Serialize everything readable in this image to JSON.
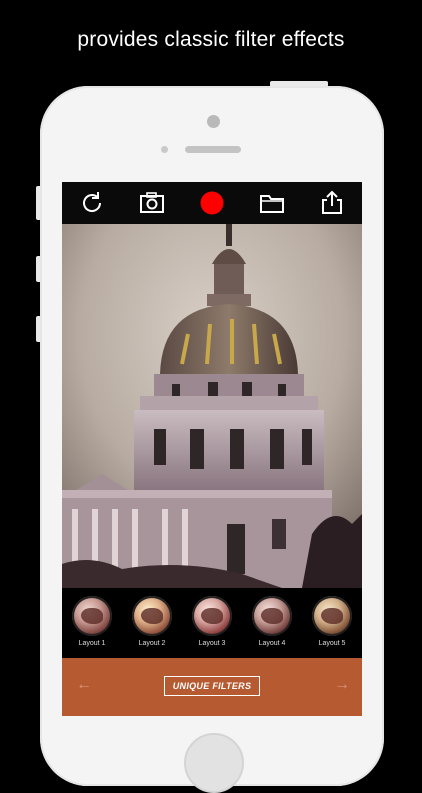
{
  "headline": "provides classic filter effects",
  "toolbar": {
    "icons": [
      "refresh-icon",
      "camera-icon",
      "record-icon",
      "folder-icon",
      "share-icon"
    ],
    "record_color": "#ff0000"
  },
  "filters": [
    {
      "label": "Layout 1"
    },
    {
      "label": "Layout 2"
    },
    {
      "label": "Layout 3"
    },
    {
      "label": "Layout 4"
    },
    {
      "label": "Layout 5"
    }
  ],
  "bottom_bar": {
    "button_label": "UNIQUE FILTERS",
    "left_arrow": "←",
    "right_arrow": "→",
    "color": "#b65a31"
  }
}
